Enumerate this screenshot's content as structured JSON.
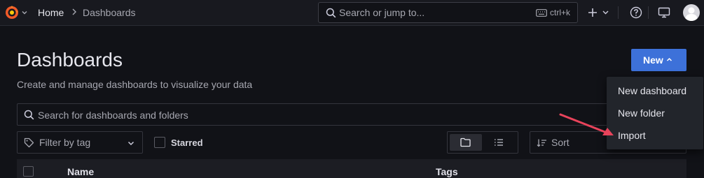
{
  "topbar": {
    "breadcrumb_home": "Home",
    "breadcrumb_current": "Dashboards",
    "search_placeholder": "Search or jump to...",
    "search_shortcut": "ctrl+k"
  },
  "header": {
    "title": "Dashboards",
    "subtitle": "Create and manage dashboards to visualize your data",
    "new_button": "New"
  },
  "filters": {
    "search_placeholder": "Search for dashboards and folders",
    "tag_placeholder": "Filter by tag",
    "starred_label": "Starred",
    "sort_label": "Sort"
  },
  "table": {
    "columns": [
      "Name",
      "Tags"
    ]
  },
  "new_menu": {
    "items": [
      "New dashboard",
      "New folder",
      "Import"
    ]
  },
  "colors": {
    "background": "#111217",
    "topbar": "#18191f",
    "primary_button": "#3d71d9",
    "annotation_arrow": "#e8435b"
  },
  "icons": [
    "grafana-logo-icon",
    "chevron-down-icon",
    "chevron-right-icon",
    "search-icon",
    "keyboard-icon",
    "plus-icon",
    "help-icon",
    "tv-icon",
    "avatar-icon",
    "tag-icon",
    "folder-icon",
    "list-icon",
    "sort-icon"
  ]
}
